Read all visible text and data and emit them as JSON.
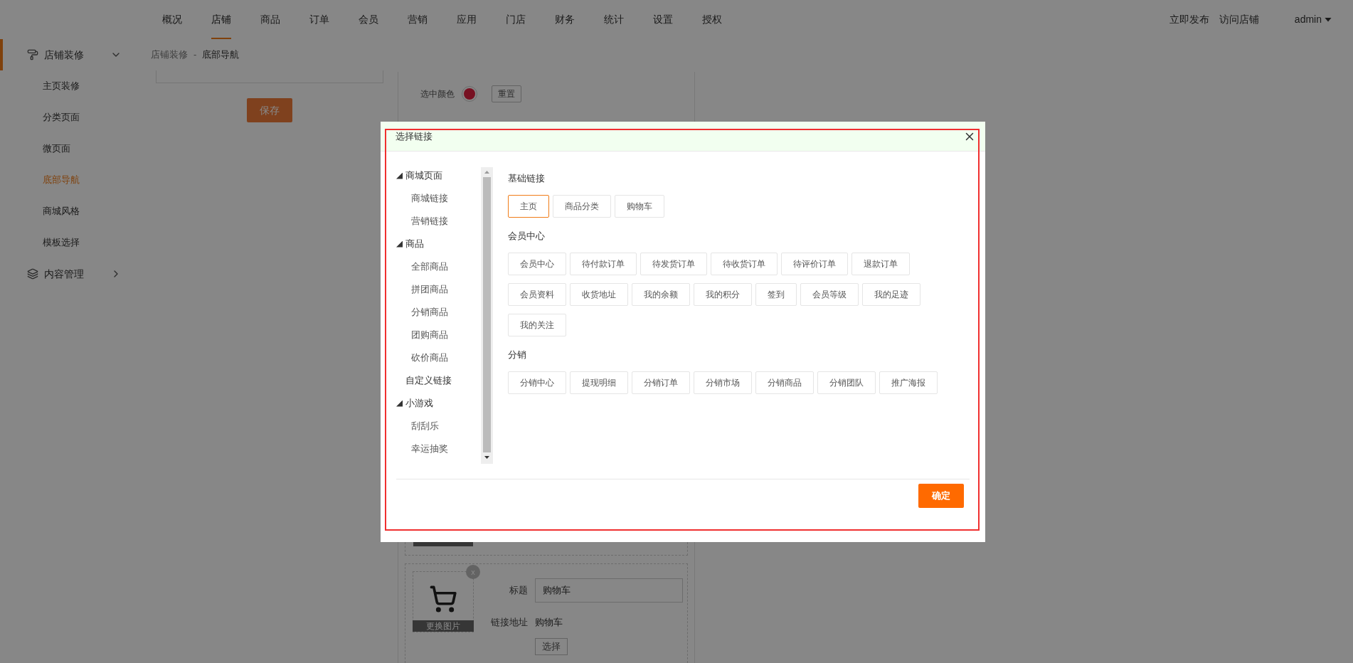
{
  "top_nav": {
    "tabs": [
      {
        "label": "概况",
        "selected": false
      },
      {
        "label": "店铺",
        "selected": true
      },
      {
        "label": "商品",
        "selected": false
      },
      {
        "label": "订单",
        "selected": false
      },
      {
        "label": "会员",
        "selected": false
      },
      {
        "label": "营销",
        "selected": false
      },
      {
        "label": "应用",
        "selected": false
      },
      {
        "label": "门店",
        "selected": false
      },
      {
        "label": "财务",
        "selected": false
      },
      {
        "label": "统计",
        "selected": false
      },
      {
        "label": "设置",
        "selected": false
      },
      {
        "label": "授权",
        "selected": false
      }
    ],
    "actions": [
      "立即发布",
      "访问店铺"
    ],
    "user": "admin"
  },
  "sidebar": {
    "groups": [
      {
        "label": "店铺装修",
        "kind": "decoration",
        "expanded": true,
        "selected": true,
        "items": [
          {
            "label": "主页装修",
            "selected": false
          },
          {
            "label": "分类页面",
            "selected": false
          },
          {
            "label": "微页面",
            "selected": false
          },
          {
            "label": "底部导航",
            "selected": true
          },
          {
            "label": "商城风格",
            "selected": false
          },
          {
            "label": "模板选择",
            "selected": false
          }
        ]
      },
      {
        "label": "内容管理",
        "kind": "content",
        "expanded": false,
        "selected": false
      }
    ]
  },
  "breadcrumb": {
    "items": [
      "店铺装修",
      "底部导航"
    ],
    "separator": "-"
  },
  "editor": {
    "save_button": "保存",
    "color_label": "选中颜色",
    "reset_button": "重置",
    "card": {
      "image_button": "更换图片",
      "remove": "x",
      "title_label": "标题",
      "title_value": "购物车",
      "link_label": "链接地址",
      "link_value": "购物车",
      "choose_button": "选择"
    }
  },
  "modal": {
    "title": "选择链接",
    "tree": [
      {
        "label": "商城页面",
        "expanded": true,
        "children": [
          {
            "label": "商城链接"
          },
          {
            "label": "营销链接"
          }
        ]
      },
      {
        "label": "商品",
        "expanded": true,
        "children": [
          {
            "label": "全部商品"
          },
          {
            "label": "拼团商品"
          },
          {
            "label": "分销商品"
          },
          {
            "label": "团购商品"
          },
          {
            "label": "砍价商品"
          }
        ]
      },
      {
        "label": "自定义链接"
      },
      {
        "label": "小游戏",
        "expanded": true,
        "children": [
          {
            "label": "刮刮乐"
          },
          {
            "label": "幸运抽奖"
          }
        ]
      }
    ],
    "sections": [
      {
        "heading": "基础链接",
        "links": [
          {
            "label": "主页",
            "selected": true
          },
          {
            "label": "商品分类",
            "selected": false
          },
          {
            "label": "购物车",
            "selected": false
          }
        ]
      },
      {
        "heading": "会员中心",
        "links": [
          {
            "label": "会员中心",
            "selected": false
          },
          {
            "label": "待付款订单",
            "selected": false
          },
          {
            "label": "待发货订单",
            "selected": false
          },
          {
            "label": "待收货订单",
            "selected": false
          },
          {
            "label": "待评价订单",
            "selected": false
          },
          {
            "label": "退款订单",
            "selected": false
          },
          {
            "label": "会员资料",
            "selected": false
          },
          {
            "label": "收货地址",
            "selected": false
          },
          {
            "label": "我的余额",
            "selected": false
          },
          {
            "label": "我的积分",
            "selected": false
          },
          {
            "label": "签到",
            "selected": false
          },
          {
            "label": "会员等级",
            "selected": false
          },
          {
            "label": "我的足迹",
            "selected": false
          },
          {
            "label": "我的关注",
            "selected": false
          }
        ]
      },
      {
        "heading": "分销",
        "links": [
          {
            "label": "分销中心",
            "selected": false
          },
          {
            "label": "提现明细",
            "selected": false
          },
          {
            "label": "分销订单",
            "selected": false
          },
          {
            "label": "分销市场",
            "selected": false
          },
          {
            "label": "分销商品",
            "selected": false
          },
          {
            "label": "分销团队",
            "selected": false
          },
          {
            "label": "推广海报",
            "selected": false
          }
        ]
      }
    ],
    "confirm_button": "确定"
  }
}
